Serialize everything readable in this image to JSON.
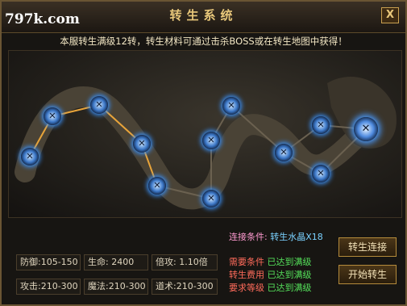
{
  "watermark": "797k.com",
  "title": "转生系统",
  "close_label": "X",
  "notice": "本服转生满级12转，转生材料可通过击杀BOSS或在转生地图中获得！",
  "stage": {
    "nodes": [
      {
        "id": 1,
        "glyph": "✕"
      },
      {
        "id": 2,
        "glyph": "✕"
      },
      {
        "id": 3,
        "glyph": "✕"
      },
      {
        "id": 4,
        "glyph": "✕"
      },
      {
        "id": 5,
        "glyph": "✕"
      },
      {
        "id": 6,
        "glyph": "✕"
      },
      {
        "id": 7,
        "glyph": "✕"
      },
      {
        "id": 8,
        "glyph": "✕"
      },
      {
        "id": 9,
        "glyph": "✕"
      },
      {
        "id": 10,
        "glyph": "✕"
      },
      {
        "id": 11,
        "glyph": "✕"
      },
      {
        "id": 12,
        "glyph": "✕"
      }
    ],
    "colors": {
      "active_line": "#e8a43a",
      "inactive_line": "#6b6150",
      "node_glow": "#3a8df0"
    }
  },
  "connect_condition": {
    "label": "连接条件:",
    "value": "转生水晶X18"
  },
  "stats": {
    "defense": "防御:105-150",
    "life": "生命: 2400",
    "crit": "倍攻: 1.10倍",
    "attack": "攻击:210-300",
    "magic": "魔法:210-300",
    "taoism": "道术:210-300"
  },
  "requirements": [
    {
      "label": "需要条件",
      "value": "已达到满级"
    },
    {
      "label": "转生费用",
      "value": "已达到满级"
    },
    {
      "label": "要求等级",
      "value": "已达到满级"
    }
  ],
  "buttons": {
    "connect": "转生连接",
    "start": "开始转生"
  }
}
